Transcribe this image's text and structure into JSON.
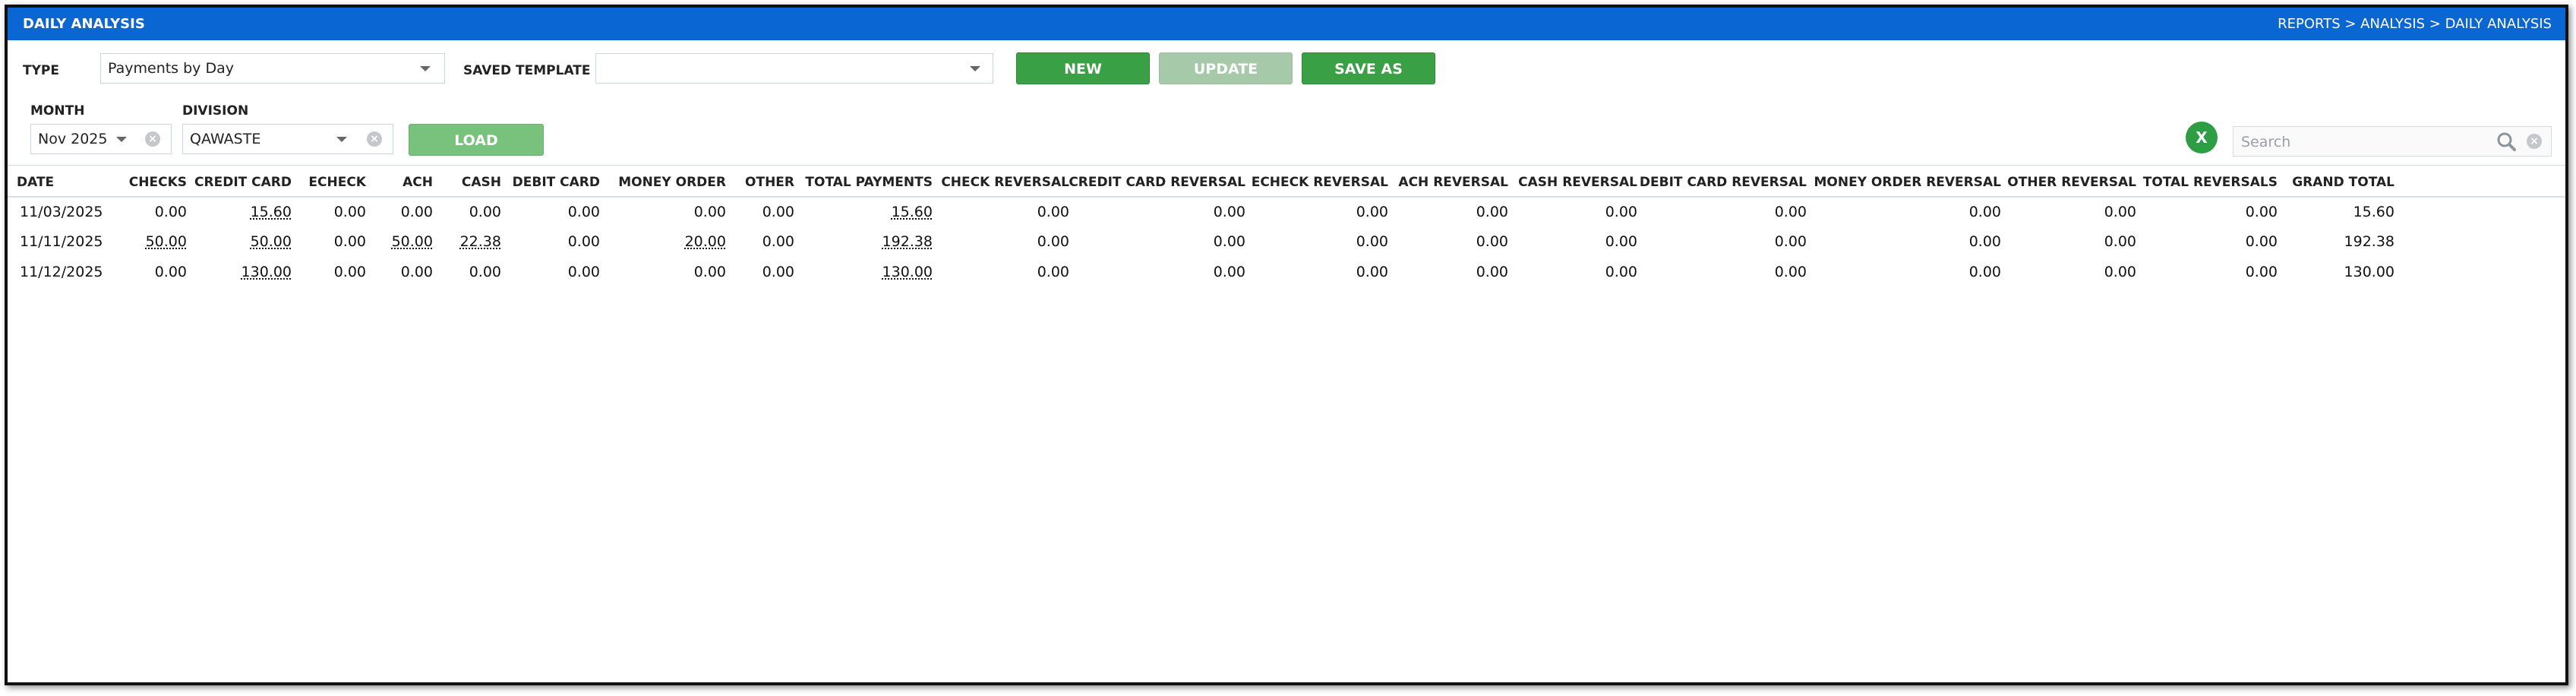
{
  "header": {
    "title": "DAILY ANALYSIS",
    "breadcrumb": "REPORTS > ANALYSIS > DAILY ANALYSIS"
  },
  "filters": {
    "type_label": "TYPE",
    "type_value": "Payments by Day",
    "template_label": "SAVED TEMPLATE",
    "template_value": "",
    "month_label": "MONTH",
    "month_value": "Nov 2025",
    "division_label": "DIVISION",
    "division_value": "QAWASTE"
  },
  "buttons": {
    "new": "NEW",
    "update": "UPDATE",
    "save_as": "SAVE AS",
    "load": "LOAD"
  },
  "search": {
    "placeholder": "Search"
  },
  "table": {
    "columns": [
      "DATE",
      "CHECKS",
      "CREDIT CARD",
      "ECHECK",
      "ACH",
      "CASH",
      "DEBIT CARD",
      "MONEY ORDER",
      "OTHER",
      "TOTAL PAYMENTS",
      "CHECK REVERSAL",
      "CREDIT CARD REVERSAL",
      "ECHECK REVERSAL",
      "ACH REVERSAL",
      "CASH REVERSAL",
      "DEBIT CARD REVERSAL",
      "MONEY ORDER REVERSAL",
      "OTHER REVERSAL",
      "TOTAL REVERSALS",
      "GRAND TOTAL"
    ],
    "rows": [
      [
        "11/03/2025",
        "0.00",
        "15.60",
        "0.00",
        "0.00",
        "0.00",
        "0.00",
        "0.00",
        "0.00",
        "15.60",
        "0.00",
        "0.00",
        "0.00",
        "0.00",
        "0.00",
        "0.00",
        "0.00",
        "0.00",
        "0.00",
        "15.60"
      ],
      [
        "11/11/2025",
        "50.00",
        "50.00",
        "0.00",
        "50.00",
        "22.38",
        "0.00",
        "20.00",
        "0.00",
        "192.38",
        "0.00",
        "0.00",
        "0.00",
        "0.00",
        "0.00",
        "0.00",
        "0.00",
        "0.00",
        "0.00",
        "192.38"
      ],
      [
        "11/12/2025",
        "0.00",
        "130.00",
        "0.00",
        "0.00",
        "0.00",
        "0.00",
        "0.00",
        "0.00",
        "130.00",
        "0.00",
        "0.00",
        "0.00",
        "0.00",
        "0.00",
        "0.00",
        "0.00",
        "0.00",
        "0.00",
        "130.00"
      ]
    ]
  }
}
